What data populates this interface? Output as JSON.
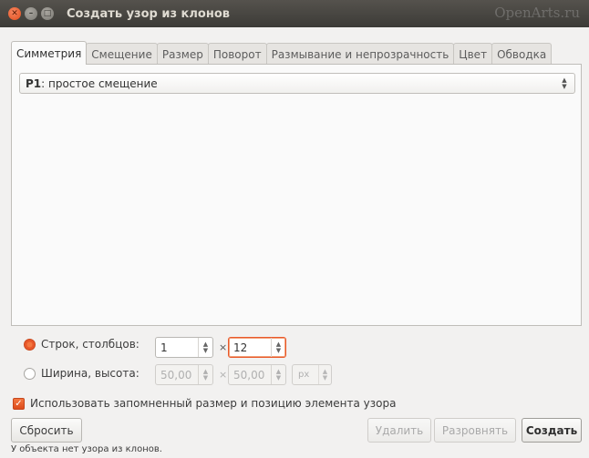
{
  "window": {
    "title": "Создать узор из клонов",
    "watermark": "OpenArts.ru"
  },
  "tabs": [
    {
      "label": "Симметрия",
      "active": true
    },
    {
      "label": "Смещение",
      "active": false
    },
    {
      "label": "Размер",
      "active": false
    },
    {
      "label": "Поворот",
      "active": false
    },
    {
      "label": "Размывание и непрозрачность",
      "active": false
    },
    {
      "label": "Цвет",
      "active": false
    },
    {
      "label": "Обводка",
      "active": false
    }
  ],
  "symmetry": {
    "selected_prefix": "P1",
    "selected_text": ": простое смещение"
  },
  "rows_cols": {
    "label": "Строк, столбцов:",
    "rows": "1",
    "cols": "12",
    "selected": true
  },
  "width_height": {
    "label": "Ширина, высота:",
    "width": "50,00",
    "height": "50,00",
    "unit": "px",
    "selected": false
  },
  "times_sign": "×",
  "remember_size": {
    "label": "Использовать запомненный размер и позицию элемента узора",
    "checked": true
  },
  "buttons": {
    "reset": "Сбросить",
    "delete": "Удалить",
    "align": "Разровнять",
    "create": "Создать"
  },
  "status_text": "У объекта нет узора из клонов."
}
